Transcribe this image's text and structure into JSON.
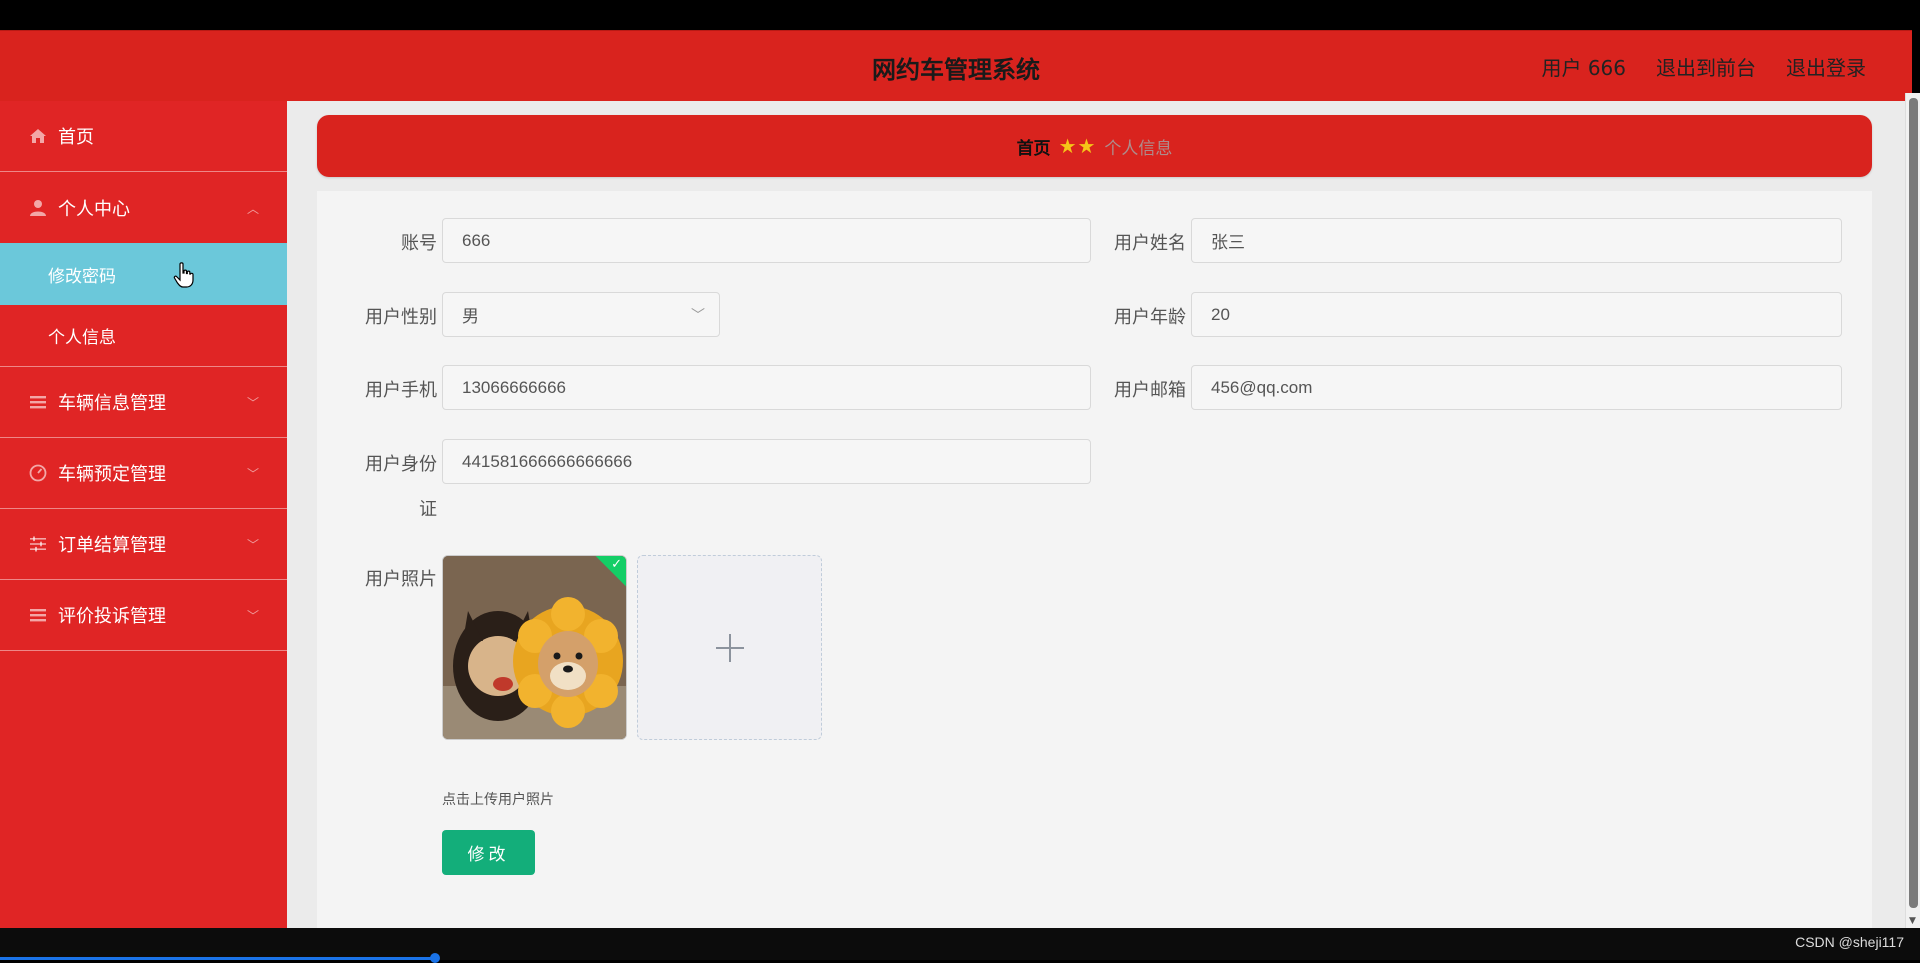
{
  "header": {
    "title": "网约车管理系统",
    "user_label": "用户 666",
    "to_front_label": "退出到前台",
    "logout_label": "退出登录"
  },
  "sidebar": {
    "home": "首页",
    "personal_center": "个人中心",
    "sub_change_password": "修改密码",
    "sub_personal_info": "个人信息",
    "vehicle_info": "车辆信息管理",
    "vehicle_booking": "车辆预定管理",
    "order_settlement": "订单结算管理",
    "review_complaint": "评价投诉管理"
  },
  "breadcrumb": {
    "home": "首页",
    "separator": "★★",
    "current": "个人信息"
  },
  "form": {
    "account_label": "账号",
    "account_value": "666",
    "name_label": "用户姓名",
    "name_value": "张三",
    "gender_label": "用户性别",
    "gender_value": "男",
    "age_label": "用户年龄",
    "age_value": "20",
    "phone_label": "用户手机",
    "phone_value": "13066666666",
    "email_label": "用户邮箱",
    "email_value": "456@qq.com",
    "idcard_label_line1": "用户身份",
    "idcard_label_line2": "证",
    "idcard_value": "441581666666666666",
    "photo_label": "用户照片",
    "upload_tip": "点击上传用户照片",
    "submit_label": "修改"
  },
  "footer": {
    "watermark": "CSDN @sheji117"
  },
  "colors": {
    "brand_red": "#d9231e",
    "active_menu": "#6bc8da",
    "submit_green": "#13ae7a"
  },
  "icons": {
    "home": "home-icon",
    "user": "user-icon",
    "list": "list-icon",
    "gauge": "gauge-icon",
    "sliders": "sliders-icon",
    "plus": "plus-icon"
  }
}
